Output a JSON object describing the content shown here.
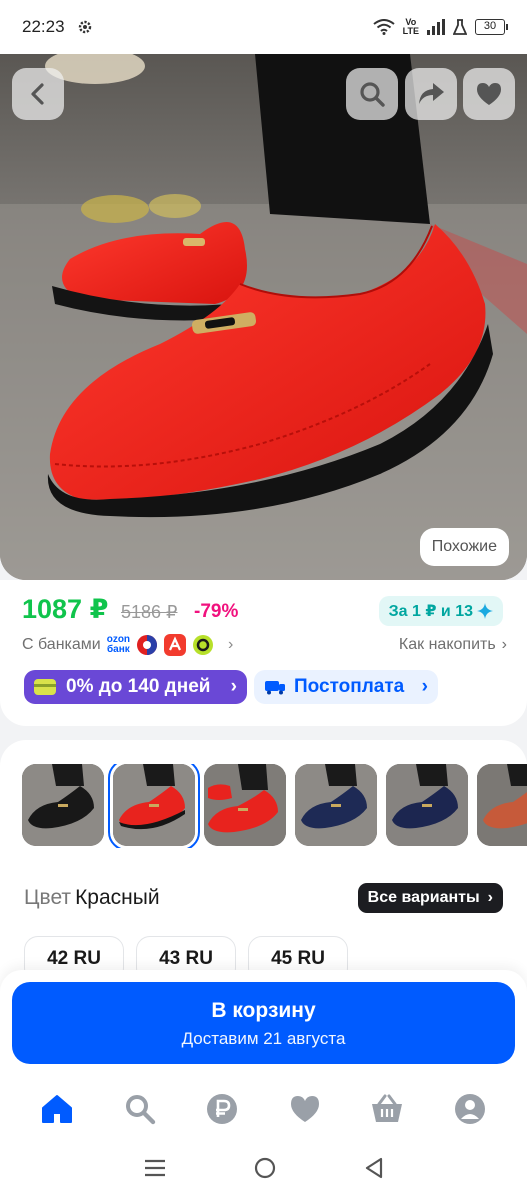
{
  "status_bar": {
    "time": "22:23",
    "network_top": "Vo",
    "network_bottom": "LTE",
    "battery": "30"
  },
  "product": {
    "similar_label": "Похожие",
    "price": "1087 ₽",
    "old_price": "5186 ₽",
    "discount": "-79%",
    "bonus": "За 1 ₽ и 13",
    "banks_label": "С банками",
    "ozon_bank_line1": "ozon",
    "ozon_bank_line2": "банк",
    "save_link": "Как накопить",
    "installment": "0% до 140 дней",
    "postpay": "Постоплата"
  },
  "variants": {
    "color_label": "Цвет",
    "color_value": "Красный",
    "all_variants": "Все варианты",
    "thumbnails": [
      {
        "shoe": "black"
      },
      {
        "shoe": "red",
        "selected": true
      },
      {
        "shoe": "red"
      },
      {
        "shoe": "navy"
      },
      {
        "shoe": "navy"
      },
      {
        "shoe": "orange"
      }
    ],
    "sizes": [
      "42 RU",
      "43 RU",
      "45 RU"
    ]
  },
  "cart": {
    "title": "В корзину",
    "subtitle": "Доставим 21 августа"
  },
  "colors": {
    "accent": "#005bff",
    "price": "#10c44c",
    "discount": "#f1117e",
    "bonus": "#00a6a0",
    "installment": "#6a48d6",
    "shoe_red": "#e8231e"
  },
  "bottom_nav": [
    "home-icon",
    "search-icon",
    "ruble-icon",
    "heart-icon",
    "basket-icon",
    "profile-icon"
  ],
  "system_nav": [
    "menu-icon",
    "home-circle-icon",
    "back-triangle-icon"
  ]
}
